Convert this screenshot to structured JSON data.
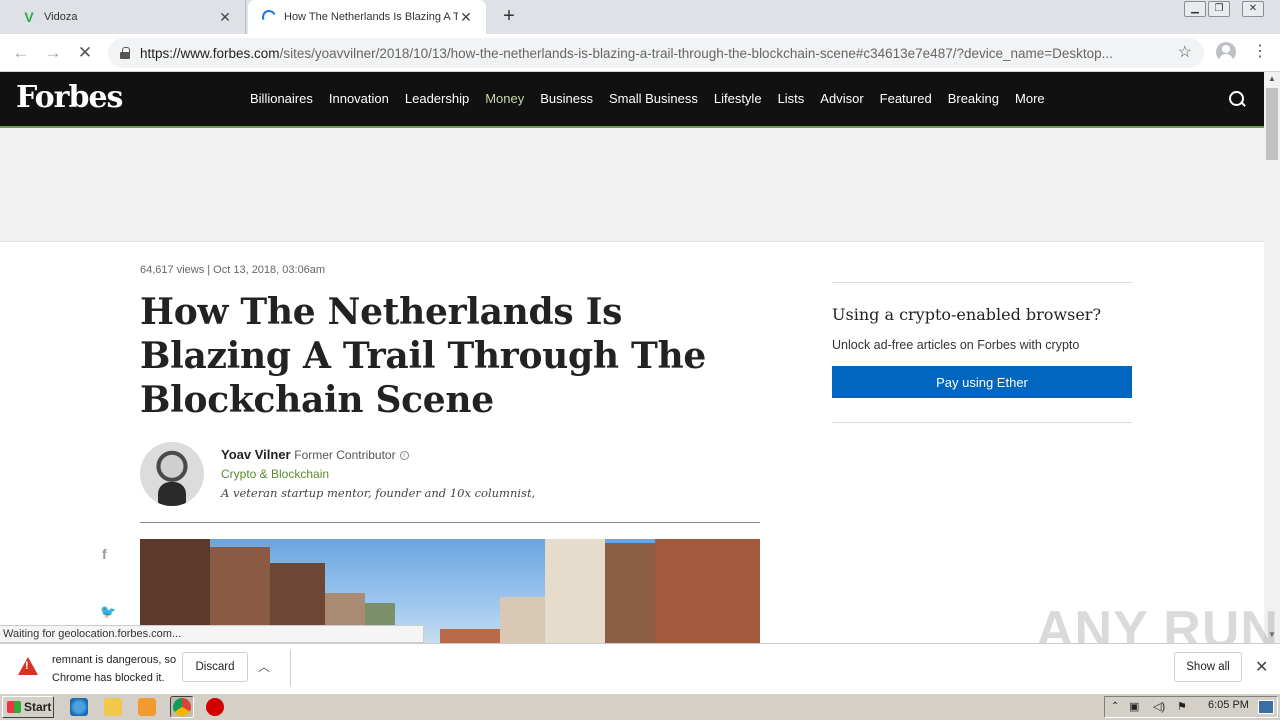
{
  "browser": {
    "tabs": [
      {
        "title": "Vidoza",
        "favicon": "vidoza-icon"
      },
      {
        "title": "How The Netherlands Is Blazing A Tr",
        "favicon": "loading-spinner-icon"
      }
    ],
    "url_host": "https://www.forbes.com",
    "url_rest": "/sites/yoavvilner/2018/10/13/how-the-netherlands-is-blazing-a-trail-through-the-blockchain-scene#c34613e7e487/?device_name=Desktop...",
    "status_text": "Waiting for geolocation.forbes.com..."
  },
  "forbes_nav": {
    "logo": "Forbes",
    "items": [
      "Billionaires",
      "Innovation",
      "Leadership",
      "Money",
      "Business",
      "Small Business",
      "Lifestyle",
      "Lists",
      "Advisor",
      "Featured",
      "Breaking",
      "More"
    ],
    "accent": "#6f9c48"
  },
  "article": {
    "meta": "64,617 views  |  Oct 13, 2018, 03:06am",
    "headline": "How The Netherlands Is Blazing A Trail Through The Blockchain Scene",
    "author_name": "Yoav Vilner",
    "author_role": "Former Contributor",
    "topic": "Crypto & Blockchain",
    "bio": "A veteran startup mentor, founder and 10x columnist,"
  },
  "sidebar": {
    "title": "Using a crypto-enabled browser?",
    "subtitle": "Unlock ad-free articles on Forbes with crypto",
    "button_label": "Pay using Ether",
    "button_color": "#0066bf"
  },
  "download_bar": {
    "message_line1": "remnant is dangerous, so",
    "message_line2": "Chrome has blocked it.",
    "discard_label": "Discard",
    "show_all_label": "Show all"
  },
  "watermark": "ANY RUN",
  "taskbar": {
    "start_label": "Start",
    "clock": "6:05 PM"
  }
}
